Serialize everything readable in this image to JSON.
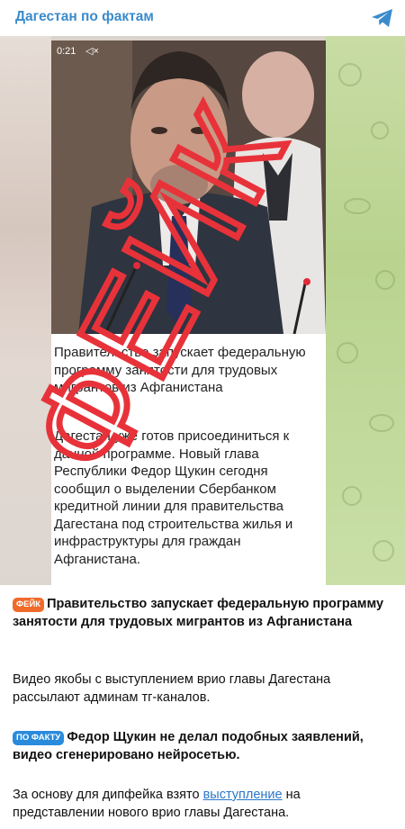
{
  "header": {
    "channel_title": "Дагестан по фактам",
    "share_icon": "telegram-plane-icon"
  },
  "video": {
    "time": "0:21",
    "mute_icon": "speaker-muted-icon"
  },
  "fake_stamp": "ФЕЙК",
  "panel": {
    "paragraph1": "Правительство запускает федеральную программу занятости для трудовых мигрантов из Афганистана",
    "paragraph2": "Дагестан уже готов присоединиться к данной программе. Новый глава Республики Федор Щукин сегодня сообщил о выделении Сбербанком кредитной линии для правительства Дагестана под строительства жилья и инфраструктуры для граждан Афганистана."
  },
  "caption": {
    "fake_badge": "ФЕЙК",
    "fake_title": "Правительство запускает федеральную программу занятости для трудовых мигрантов из Афганистана",
    "text1": "Видео якобы с выступлением врио главы Дагестана рассылают админам тг-каналов.",
    "fact_badge": "ПО ФАКТУ",
    "fact_title": "Федор Щукин не делал подобных заявлений, видео сгенерировано нейросетью.",
    "text2_before": "За основу для дипфейка взято",
    "text2_link": "выступление",
    "text2_after": "на представлении нового врио главы Дагестана."
  },
  "colors": {
    "title_blue": "#3a8bcc",
    "stamp_red": "#e8323a",
    "fake_badge": "#f06a2a",
    "fact_badge": "#2a8bdc",
    "link": "#2a77c9"
  }
}
